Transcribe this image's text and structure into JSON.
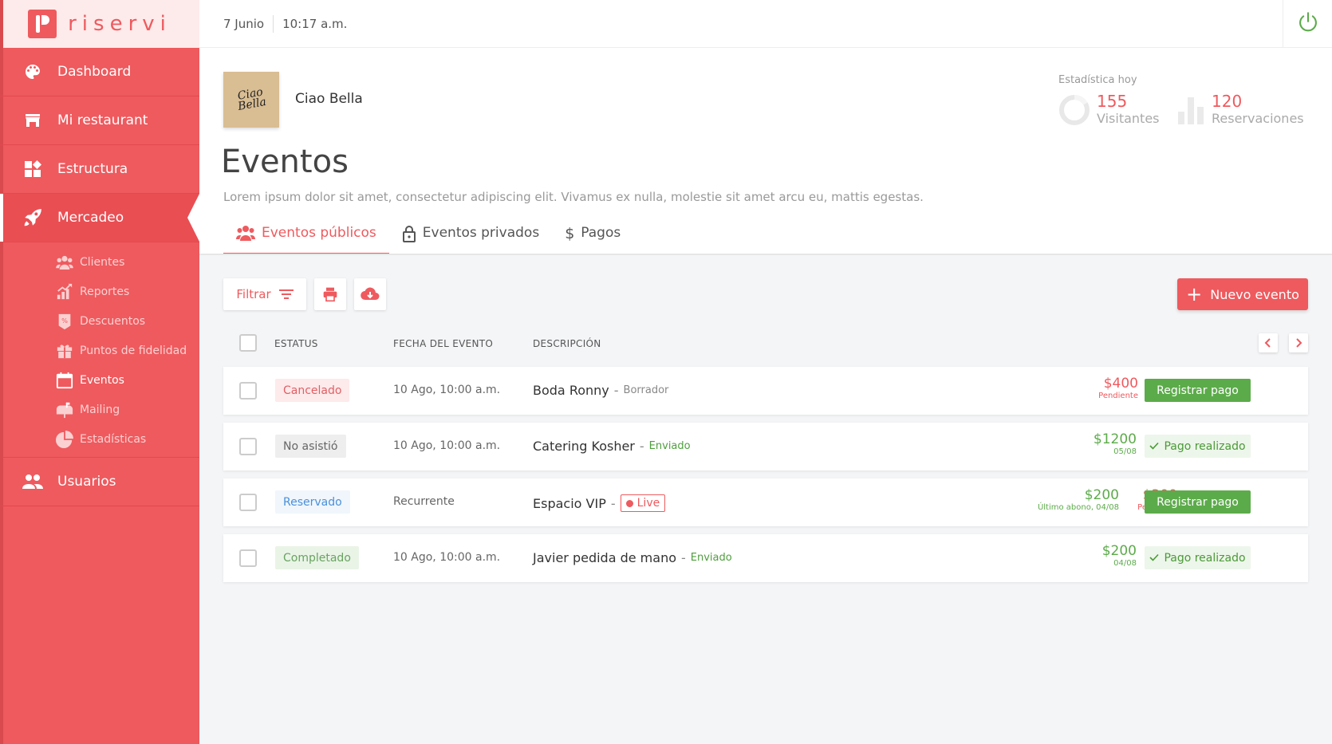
{
  "brand": {
    "name": "riservi"
  },
  "topbar": {
    "date": "7 Junio",
    "time": "10:17 a.m."
  },
  "sidebar": {
    "items": [
      {
        "label": "Dashboard",
        "icon": "palette-icon"
      },
      {
        "label": "Mi restaurant",
        "icon": "store-icon"
      },
      {
        "label": "Estructura",
        "icon": "widgets-icon"
      },
      {
        "label": "Mercadeo",
        "icon": "rocket-icon",
        "active": true
      },
      {
        "label": "Usuarios",
        "icon": "users-icon"
      }
    ],
    "sub_items": [
      {
        "label": "Clientes",
        "icon": "users-icon"
      },
      {
        "label": "Reportes",
        "icon": "chart-icon"
      },
      {
        "label": "Descuentos",
        "icon": "discount-tag-icon"
      },
      {
        "label": "Puntos de fidelidad",
        "icon": "gift-icon"
      },
      {
        "label": "Eventos",
        "icon": "calendar-icon",
        "current": true
      },
      {
        "label": "Mailing",
        "icon": "mailbox-icon"
      },
      {
        "label": "Estadísticas",
        "icon": "pie-chart-icon"
      }
    ]
  },
  "restaurant": {
    "logo_text": "Ciao Bella",
    "name": "Ciao Bella"
  },
  "stats": {
    "label": "Estadística hoy",
    "visitors": {
      "value": "155",
      "label": "Visitantes"
    },
    "reservations": {
      "value": "120",
      "label": "Reservaciones"
    }
  },
  "page": {
    "title": "Eventos",
    "description": "Lorem ipsum dolor sit amet, consectetur adipiscing elit. Vivamus ex nulla, molestie sit amet arcu eu, mattis egestas."
  },
  "tabs": [
    {
      "label": "Eventos públicos",
      "active": true
    },
    {
      "label": "Eventos privados"
    },
    {
      "label": "Pagos"
    }
  ],
  "toolbar": {
    "filter_label": "Filtrar",
    "new_event_label": "Nuevo evento"
  },
  "table": {
    "headers": {
      "status": "ESTATUS",
      "date": "FECHA DEL EVENTO",
      "description": "DESCRIPCIÓN"
    },
    "rows": [
      {
        "status": "Cancelado",
        "date": "10 Ago, 10:00 a.m.",
        "name": "Boda Ronny",
        "state": "Borrador",
        "amount": "$400",
        "amount_sub": "Pendiente",
        "action": "Registrar pago"
      },
      {
        "status": "No asistió",
        "date": "10 Ago, 10:00 a.m.",
        "name": "Catering Kosher",
        "state": "Enviado",
        "amount": "$1200",
        "amount_sub": "05/08",
        "action": "Pago realizado"
      },
      {
        "status": "Reservado",
        "date": "Recurrente",
        "name": "Espacio VIP",
        "live": "Live",
        "paid_amount": "$200",
        "paid_sub": "Último abono, 04/08",
        "amount": "$300",
        "amount_sub": "Pendiente",
        "action": "Registrar pago"
      },
      {
        "status": "Completado",
        "date": "10 Ago, 10:00 a.m.",
        "name": "Javier pedida de mano",
        "state": "Enviado",
        "amount": "$200",
        "amount_sub": "04/08",
        "action": "Pago realizado"
      }
    ]
  },
  "colors": {
    "accent": "#ee5a5e",
    "success": "#5cab4a"
  }
}
